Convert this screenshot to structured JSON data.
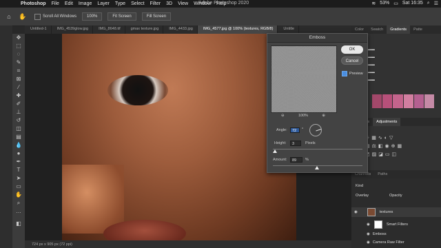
{
  "menubar": {
    "app": "Photoshop",
    "items": [
      "File",
      "Edit",
      "Image",
      "Layer",
      "Type",
      "Select",
      "Filter",
      "3D",
      "View",
      "Window",
      "Help"
    ],
    "window_title": "Adobe Photoshop 2020",
    "battery": "53%",
    "clock": "Sat 16:35"
  },
  "options": {
    "scroll_all_label": "Scroll All Windows",
    "zoom_btn": "100%",
    "fit_btn": "Fit Screen",
    "fill_btn": "Fill Screen"
  },
  "tabs": [
    {
      "label": "Untitled-1"
    },
    {
      "label": "IMG_4539glow.jpg"
    },
    {
      "label": "IMG_8648.tif"
    },
    {
      "label": "gmax texture.jpg"
    },
    {
      "label": "IMG_4433.jpg"
    },
    {
      "label": "IMG_4577.jpg @ 100% (textures, RGB/8)"
    },
    {
      "label": "Untitle"
    }
  ],
  "status": {
    "text": "724 px x 905 px (72 ppi)"
  },
  "panels": {
    "top_tabs": [
      "Color",
      "Swatch",
      "Gradients",
      "Patte"
    ],
    "adj_tabs": [
      "Libraries",
      "Adjustments"
    ],
    "layers_tabs": [
      "Channels",
      "Paths"
    ],
    "kind": "Kind",
    "blend": "Overlay",
    "opacity_label": "Opacity",
    "layers": [
      {
        "name": "textures"
      },
      {
        "name": "Smart Filters"
      },
      {
        "name": "Emboss"
      },
      {
        "name": "Camera Raw Filter"
      }
    ],
    "gradient_colors": [
      "#a3486a",
      "#b8507a",
      "#c4648c",
      "#d27ea0",
      "#b46090",
      "#c58aa6"
    ]
  },
  "emboss": {
    "title": "Emboss",
    "ok": "OK",
    "cancel": "Cancel",
    "preview_label": "Preview",
    "zoom": "100%",
    "angle_label": "Angle:",
    "angle_value": "72",
    "angle_unit": "°",
    "height_label": "Height:",
    "height_value": "3",
    "height_unit": "Pixels",
    "amount_label": "Amount:",
    "amount_value": "89",
    "amount_unit": "%"
  }
}
